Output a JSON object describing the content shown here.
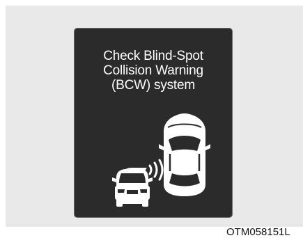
{
  "warning": {
    "lines": [
      "Check Blind-Spot",
      "Collision Warning",
      "(BCW) system"
    ]
  },
  "figure_code": "OTM058151L",
  "colors": {
    "panel_background": "#e9e9e9",
    "screen_background": "#2b2b2b",
    "text": "#ffffff",
    "vehicle": "#ffffff"
  },
  "icons": [
    "car-top-view-icon",
    "car-front-view-icon",
    "sensor-waves-icon"
  ]
}
